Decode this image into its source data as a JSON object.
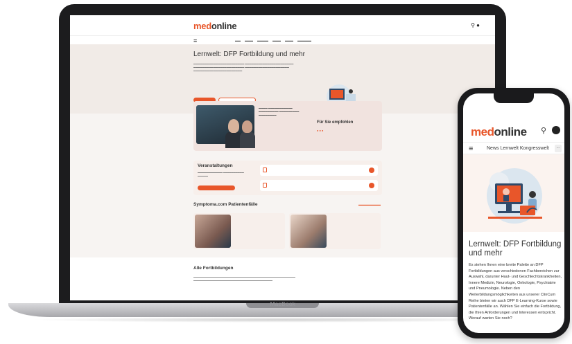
{
  "laptop": {
    "brand": "MacBook",
    "site": {
      "logo_a": "med",
      "logo_b": "online",
      "hero_title": "Lernwelt: DFP Fortbildung und mehr",
      "card_recommend": "Für Sie empfohlen",
      "events_title": "Veranstaltungen",
      "symptoma_title": "Symptoma.com Patientenfälle",
      "all_title": "Alle Fortbildungen"
    }
  },
  "phone": {
    "logo_a": "med",
    "logo_b": "online",
    "nav": "News  Lernwelt  Kongresswelt",
    "more": "...",
    "hero_title": "Lernwelt: DFP Fortbildung und mehr",
    "hero_text": "Es stehen Ihnen eine breite Palette an DFP Fortbildungen aus verschiedenen Fachbereichen zur Auswahl, darunter Haut- und Geschlechtskrankheiten, Innere Medizin, Neurologie, Onkologie, Psychiatrie und Pneumologie. Neben den Weiterbildungsmöglichkeiten aus unserer ClinCum Reihe bieten wir auch DFP E-Learning-Kurse sowie Patientenfälle an. Wählen Sie einfach die Fortbildung, die Ihren Anforderungen und Interessen entspricht. Worauf warten Sie noch?"
  },
  "colors": {
    "accent": "#e8562a",
    "hero_bg": "#f1ebe7",
    "device_frame": "#1c1c1e"
  }
}
